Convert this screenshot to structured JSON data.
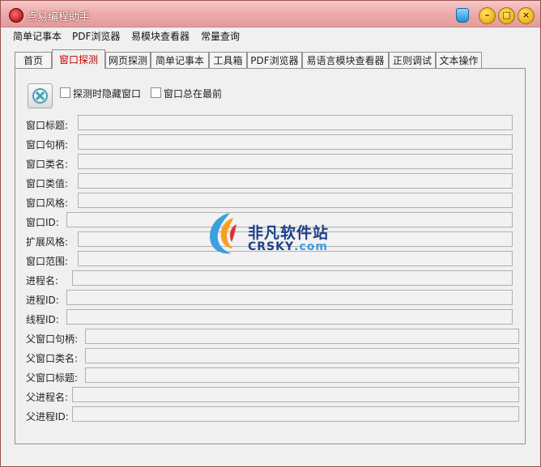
{
  "window": {
    "title": "点易编程助手"
  },
  "menu": [
    "简单记事本",
    "PDF浏览器",
    "易模块查看器",
    "常量查询"
  ],
  "tabs": [
    "首页",
    "窗口探测",
    "网页探测",
    "简单记事本",
    "工具箱",
    "PDF浏览器",
    "易语言模块查看器",
    "正则调试",
    "文本操作"
  ],
  "active_tab": "窗口探测",
  "options": {
    "hide_label": "探测时隐藏窗口",
    "topmost_label": "窗口总在最前"
  },
  "fields": [
    {
      "label": "窗口标题:",
      "value": ""
    },
    {
      "label": "窗口句柄:",
      "value": ""
    },
    {
      "label": "窗口类名:",
      "value": ""
    },
    {
      "label": "窗口类值:",
      "value": ""
    },
    {
      "label": "窗口风格:",
      "value": ""
    },
    {
      "label": "窗口ID:",
      "value": ""
    },
    {
      "label": "扩展风格:",
      "value": ""
    },
    {
      "label": "窗口范围:",
      "value": ""
    },
    {
      "label": "进程名:",
      "value": ""
    },
    {
      "label": "进程ID:",
      "value": ""
    },
    {
      "label": "线程ID:",
      "value": ""
    },
    {
      "label": "父窗口句柄:",
      "value": ""
    },
    {
      "label": "父窗口类名:",
      "value": ""
    },
    {
      "label": "父窗口标题:",
      "value": ""
    },
    {
      "label": "父进程名:",
      "value": ""
    },
    {
      "label": "父进程ID:",
      "value": ""
    }
  ],
  "watermark": {
    "cn": "非凡软件站",
    "en_main": "CRSKY",
    "en_suffix": ".com"
  },
  "icons": {
    "app": "app-logo-icon",
    "pin": "pin-icon",
    "detect": "target-crosshair-icon"
  },
  "colors": {
    "title_bar": "#eeadad",
    "active_tab_text": "#c00000",
    "watermark": "#1c3f8a"
  }
}
